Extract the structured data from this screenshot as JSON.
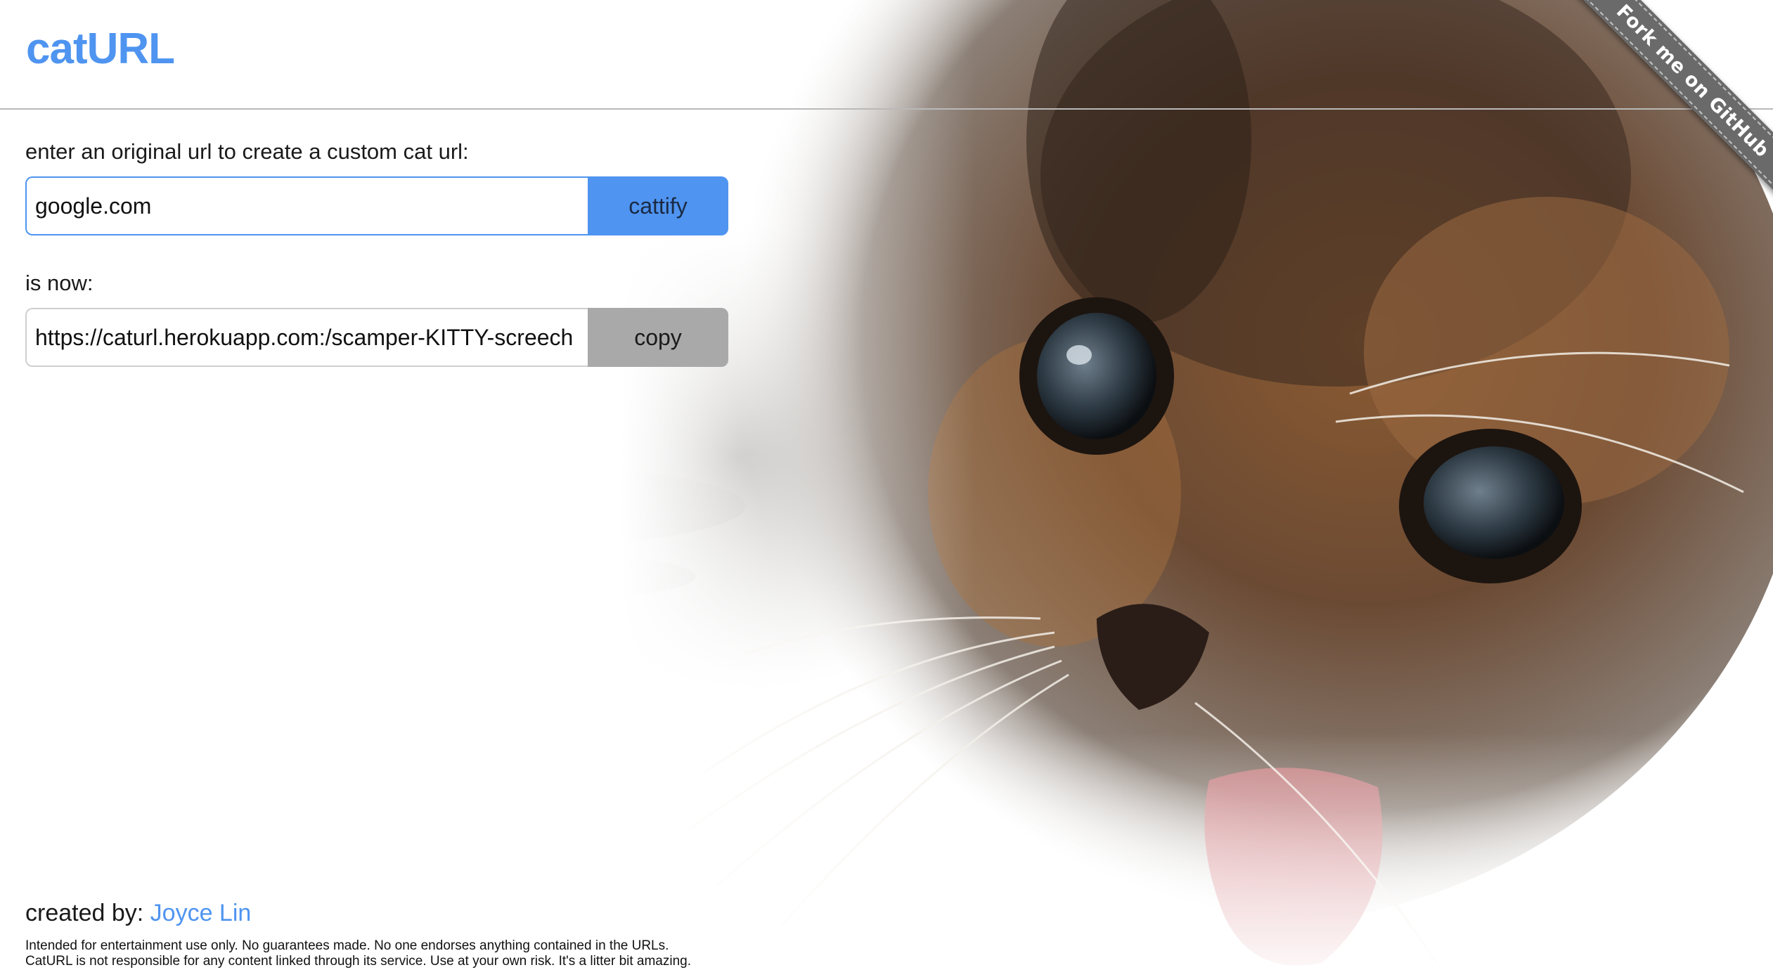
{
  "header": {
    "title": "catURL",
    "ribbon_label": "Fork me on GitHub"
  },
  "form": {
    "prompt_label": "enter an original url to create a custom cat url:",
    "original_url_value": "google.com",
    "cattify_label": "cattify",
    "result_label": "is now:",
    "result_url_value": "https://caturl.herokuapp.com:/scamper-KITTY-screech",
    "copy_label": "copy"
  },
  "footer": {
    "created_by_label": "created by:",
    "author_name": "Joyce Lin",
    "disclaimer_line1": "Intended for entertainment use only. No guarantees made. No one endorses anything contained in the URLs.",
    "disclaimer_line2": "CatURL is not responsible for any content linked through its service. Use at your own risk. It's a litter bit amazing."
  },
  "colors": {
    "accent": "#4f94f0",
    "copy_button": "#a9a9a9",
    "ribbon": "#6a6a6a"
  },
  "icons": {
    "background": "kitten-photo"
  }
}
